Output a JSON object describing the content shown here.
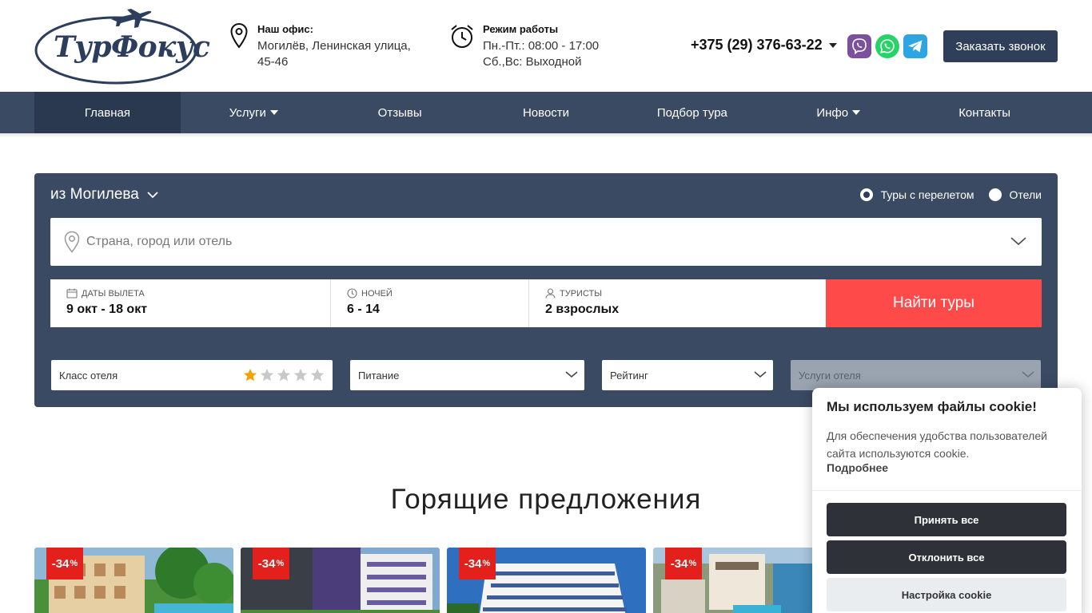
{
  "header": {
    "logo_text": "ТурФокус",
    "office": {
      "title": "Наш офис:",
      "line1": "Могилёв, Ленинская улица,",
      "line2": "45-46"
    },
    "hours": {
      "title": "Режим работы",
      "line1": "Пн.-Пт.: 08:00 - 17:00",
      "line2": "Сб.,Вс: Выходной"
    },
    "phone": "+375 (29) 376-63-22",
    "callback_label": "Заказать звонок"
  },
  "nav": {
    "home": "Главная",
    "services": "Услуги",
    "reviews": "Отзывы",
    "news": "Новости",
    "tour_selection": "Подбор тура",
    "info": "Инфо",
    "contacts": "Контакты"
  },
  "search": {
    "from_city": "из Могилева",
    "mode_flight": "Туры с перелетом",
    "mode_hotels": "Отели",
    "mode_selected": "Туры с перелетом",
    "destination_placeholder": "Страна, город или отель",
    "dates_label": "даты вылета",
    "dates_value": "9 окт - 18 окт",
    "nights_label": "ночей",
    "nights_value": "6 - 14",
    "tourists_label": "туристы",
    "tourists_value": "2 взрослых",
    "find_label": "Найти туры",
    "filters": {
      "hotel_class": "Класс отеля",
      "hotel_class_selected_stars": 1,
      "hotel_class_total_stars": 5,
      "food": "Питание",
      "rating": "Рейтинг",
      "services": "Услуги отеля"
    }
  },
  "hot_offers": {
    "title": "Горящие предложения",
    "cards": [
      {
        "discount": "-34",
        "unit": "%"
      },
      {
        "discount": "-34",
        "unit": "%"
      },
      {
        "discount": "-34",
        "unit": "%"
      },
      {
        "discount": "-34",
        "unit": "%"
      }
    ]
  },
  "cookie": {
    "title": "Мы используем файлы cookie!",
    "text": "Для обеспечения удобства пользователей сайта используются cookie.",
    "more": "Подробнее",
    "accept": "Принять все",
    "reject": "Отклонить все",
    "settings": "Настройка cookie"
  },
  "colors": {
    "navy": "#3b4a63",
    "nav_active": "#2a3850",
    "find_button": "#ff4a4a",
    "discount_badge": "#e3201b",
    "cookie_button": "#2e3238",
    "star_active": "#f4a300",
    "star_inactive": "#c8c8c8"
  },
  "icons": [
    "plane-icon",
    "location-pin-icon",
    "alarm-clock-icon",
    "viber-icon",
    "whatsapp-icon",
    "telegram-icon",
    "calendar-icon",
    "clock-icon",
    "user-icon",
    "star-icon",
    "chevron-down-icon"
  ]
}
